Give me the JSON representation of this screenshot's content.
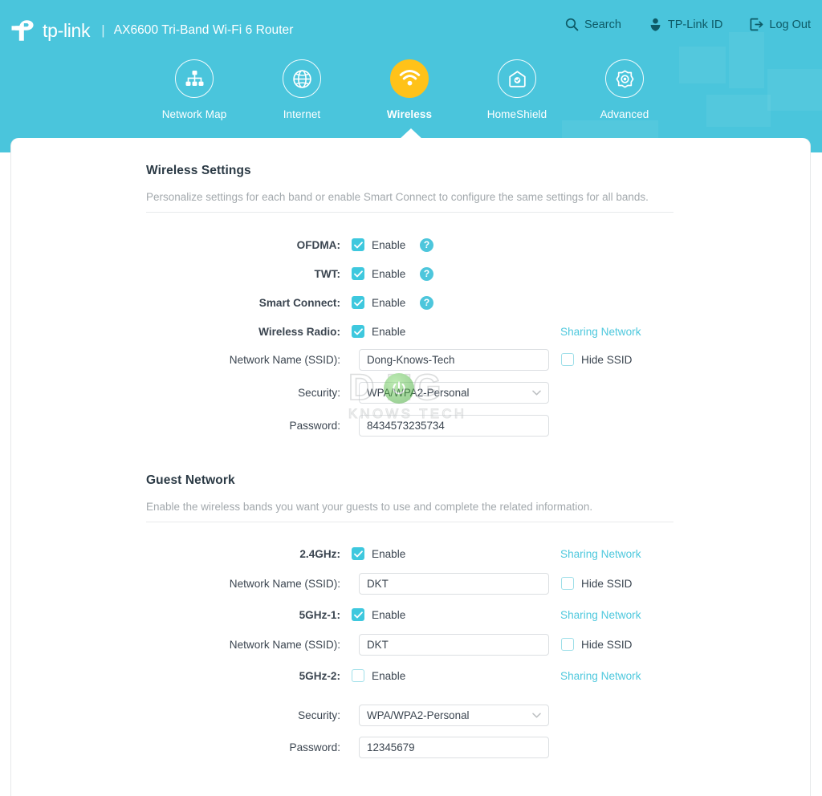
{
  "header": {
    "brand_name": "tp-link",
    "separator": "|",
    "model": "AX6600 Tri-Band Wi-Fi 6 Router",
    "actions": [
      {
        "label": "Search",
        "icon": "search-icon"
      },
      {
        "label": "TP-Link ID",
        "icon": "tplink-id-icon"
      },
      {
        "label": "Log Out",
        "icon": "logout-icon"
      }
    ],
    "accent_color": "#4ac5dc",
    "active_tab_color": "#ffc219"
  },
  "nav": {
    "tabs": [
      {
        "label": "Network Map",
        "icon": "network-map-icon",
        "active": false
      },
      {
        "label": "Internet",
        "icon": "globe-icon",
        "active": false
      },
      {
        "label": "Wireless",
        "icon": "wifi-icon",
        "active": true
      },
      {
        "label": "HomeShield",
        "icon": "home-shield-icon",
        "active": false
      },
      {
        "label": "Advanced",
        "icon": "gear-icon",
        "active": false
      }
    ]
  },
  "wireless_settings": {
    "title": "Wireless Settings",
    "description": "Personalize settings for each band or enable Smart Connect to configure the same settings for all bands.",
    "rows": {
      "ofdma": {
        "label": "OFDMA:",
        "checkbox_label": "Enable",
        "checked": true,
        "help": "?"
      },
      "twt": {
        "label": "TWT:",
        "checkbox_label": "Enable",
        "checked": true,
        "help": "?"
      },
      "smart_connect": {
        "label": "Smart Connect:",
        "checkbox_label": "Enable",
        "checked": true,
        "help": "?"
      },
      "wireless_radio": {
        "label": "Wireless Radio:",
        "checkbox_label": "Enable",
        "checked": true,
        "share_link": "Sharing Network"
      },
      "ssid": {
        "label": "Network Name (SSID):",
        "value": "Dong-Knows-Tech",
        "hide_label": "Hide SSID",
        "hide_checked": false
      },
      "security": {
        "label": "Security:",
        "value": "WPA/WPA2-Personal"
      },
      "password": {
        "label": "Password:",
        "value": "8434573235734"
      }
    }
  },
  "guest_network": {
    "title": "Guest Network",
    "description": "Enable the wireless bands you want your guests to use and complete the related information.",
    "rows": {
      "band_24": {
        "label": "2.4GHz:",
        "checkbox_label": "Enable",
        "checked": true,
        "share_link": "Sharing Network"
      },
      "ssid_24": {
        "label": "Network Name (SSID):",
        "value": "DKT",
        "hide_label": "Hide SSID",
        "hide_checked": false
      },
      "band_5_1": {
        "label": "5GHz-1:",
        "checkbox_label": "Enable",
        "checked": true,
        "share_link": "Sharing Network"
      },
      "ssid_5_1": {
        "label": "Network Name (SSID):",
        "value": "DKT",
        "hide_label": "Hide SSID",
        "hide_checked": false
      },
      "band_5_2": {
        "label": "5GHz-2:",
        "checkbox_label": "Enable",
        "checked": false,
        "share_link": "Sharing Network"
      },
      "security": {
        "label": "Security:",
        "value": "WPA/WPA2-Personal"
      },
      "password": {
        "label": "Password:",
        "value": "12345679"
      }
    }
  },
  "watermark": {
    "line1": "D NG",
    "line2": "KNOWS TECH"
  }
}
